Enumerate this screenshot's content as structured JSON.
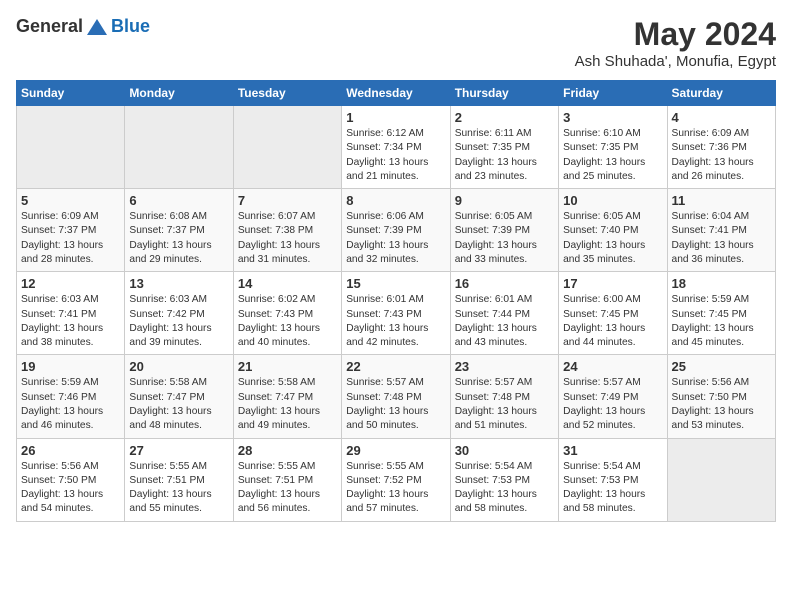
{
  "header": {
    "logo_general": "General",
    "logo_blue": "Blue",
    "title": "May 2024",
    "subtitle": "Ash Shuhada', Monufia, Egypt"
  },
  "days_of_week": [
    "Sunday",
    "Monday",
    "Tuesday",
    "Wednesday",
    "Thursday",
    "Friday",
    "Saturday"
  ],
  "weeks": [
    [
      {
        "day": "",
        "info": ""
      },
      {
        "day": "",
        "info": ""
      },
      {
        "day": "",
        "info": ""
      },
      {
        "day": "1",
        "info": "Sunrise: 6:12 AM\nSunset: 7:34 PM\nDaylight: 13 hours\nand 21 minutes."
      },
      {
        "day": "2",
        "info": "Sunrise: 6:11 AM\nSunset: 7:35 PM\nDaylight: 13 hours\nand 23 minutes."
      },
      {
        "day": "3",
        "info": "Sunrise: 6:10 AM\nSunset: 7:35 PM\nDaylight: 13 hours\nand 25 minutes."
      },
      {
        "day": "4",
        "info": "Sunrise: 6:09 AM\nSunset: 7:36 PM\nDaylight: 13 hours\nand 26 minutes."
      }
    ],
    [
      {
        "day": "5",
        "info": "Sunrise: 6:09 AM\nSunset: 7:37 PM\nDaylight: 13 hours\nand 28 minutes."
      },
      {
        "day": "6",
        "info": "Sunrise: 6:08 AM\nSunset: 7:37 PM\nDaylight: 13 hours\nand 29 minutes."
      },
      {
        "day": "7",
        "info": "Sunrise: 6:07 AM\nSunset: 7:38 PM\nDaylight: 13 hours\nand 31 minutes."
      },
      {
        "day": "8",
        "info": "Sunrise: 6:06 AM\nSunset: 7:39 PM\nDaylight: 13 hours\nand 32 minutes."
      },
      {
        "day": "9",
        "info": "Sunrise: 6:05 AM\nSunset: 7:39 PM\nDaylight: 13 hours\nand 33 minutes."
      },
      {
        "day": "10",
        "info": "Sunrise: 6:05 AM\nSunset: 7:40 PM\nDaylight: 13 hours\nand 35 minutes."
      },
      {
        "day": "11",
        "info": "Sunrise: 6:04 AM\nSunset: 7:41 PM\nDaylight: 13 hours\nand 36 minutes."
      }
    ],
    [
      {
        "day": "12",
        "info": "Sunrise: 6:03 AM\nSunset: 7:41 PM\nDaylight: 13 hours\nand 38 minutes."
      },
      {
        "day": "13",
        "info": "Sunrise: 6:03 AM\nSunset: 7:42 PM\nDaylight: 13 hours\nand 39 minutes."
      },
      {
        "day": "14",
        "info": "Sunrise: 6:02 AM\nSunset: 7:43 PM\nDaylight: 13 hours\nand 40 minutes."
      },
      {
        "day": "15",
        "info": "Sunrise: 6:01 AM\nSunset: 7:43 PM\nDaylight: 13 hours\nand 42 minutes."
      },
      {
        "day": "16",
        "info": "Sunrise: 6:01 AM\nSunset: 7:44 PM\nDaylight: 13 hours\nand 43 minutes."
      },
      {
        "day": "17",
        "info": "Sunrise: 6:00 AM\nSunset: 7:45 PM\nDaylight: 13 hours\nand 44 minutes."
      },
      {
        "day": "18",
        "info": "Sunrise: 5:59 AM\nSunset: 7:45 PM\nDaylight: 13 hours\nand 45 minutes."
      }
    ],
    [
      {
        "day": "19",
        "info": "Sunrise: 5:59 AM\nSunset: 7:46 PM\nDaylight: 13 hours\nand 46 minutes."
      },
      {
        "day": "20",
        "info": "Sunrise: 5:58 AM\nSunset: 7:47 PM\nDaylight: 13 hours\nand 48 minutes."
      },
      {
        "day": "21",
        "info": "Sunrise: 5:58 AM\nSunset: 7:47 PM\nDaylight: 13 hours\nand 49 minutes."
      },
      {
        "day": "22",
        "info": "Sunrise: 5:57 AM\nSunset: 7:48 PM\nDaylight: 13 hours\nand 50 minutes."
      },
      {
        "day": "23",
        "info": "Sunrise: 5:57 AM\nSunset: 7:48 PM\nDaylight: 13 hours\nand 51 minutes."
      },
      {
        "day": "24",
        "info": "Sunrise: 5:57 AM\nSunset: 7:49 PM\nDaylight: 13 hours\nand 52 minutes."
      },
      {
        "day": "25",
        "info": "Sunrise: 5:56 AM\nSunset: 7:50 PM\nDaylight: 13 hours\nand 53 minutes."
      }
    ],
    [
      {
        "day": "26",
        "info": "Sunrise: 5:56 AM\nSunset: 7:50 PM\nDaylight: 13 hours\nand 54 minutes."
      },
      {
        "day": "27",
        "info": "Sunrise: 5:55 AM\nSunset: 7:51 PM\nDaylight: 13 hours\nand 55 minutes."
      },
      {
        "day": "28",
        "info": "Sunrise: 5:55 AM\nSunset: 7:51 PM\nDaylight: 13 hours\nand 56 minutes."
      },
      {
        "day": "29",
        "info": "Sunrise: 5:55 AM\nSunset: 7:52 PM\nDaylight: 13 hours\nand 57 minutes."
      },
      {
        "day": "30",
        "info": "Sunrise: 5:54 AM\nSunset: 7:53 PM\nDaylight: 13 hours\nand 58 minutes."
      },
      {
        "day": "31",
        "info": "Sunrise: 5:54 AM\nSunset: 7:53 PM\nDaylight: 13 hours\nand 58 minutes."
      },
      {
        "day": "",
        "info": ""
      }
    ]
  ]
}
